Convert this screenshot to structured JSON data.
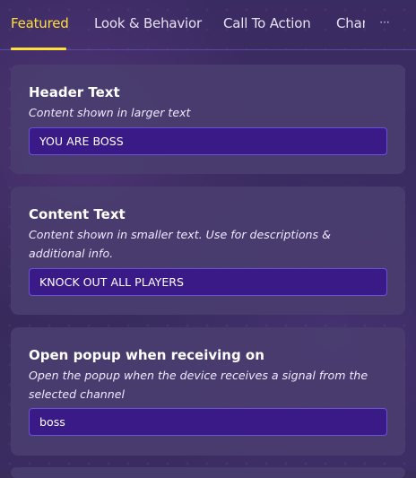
{
  "tabs": [
    {
      "label": "Featured",
      "active": true
    },
    {
      "label": "Look & Behavior",
      "active": false
    },
    {
      "label": "Call To Action",
      "active": false
    },
    {
      "label": "Channels",
      "active": false
    }
  ],
  "more_icon": {
    "glyph": "···",
    "icon": "more-horizontal-icon"
  },
  "colors": {
    "active_tab": "#ffe03a",
    "card_background": "#4a3d6f",
    "input_background": "#3a1a86",
    "input_border": "#6a52d6"
  },
  "settings": [
    {
      "title": "Header Text",
      "description": "Content shown in larger text",
      "value": "YOU ARE BOSS"
    },
    {
      "title": "Content Text",
      "description": "Content shown in smaller text. Use for descriptions & additional info.",
      "value": "KNOCK OUT ALL PLAYERS"
    },
    {
      "title": "Open popup when receiving on",
      "description": "Open the popup when the device receives a signal from the selected channel",
      "value": "boss"
    }
  ]
}
